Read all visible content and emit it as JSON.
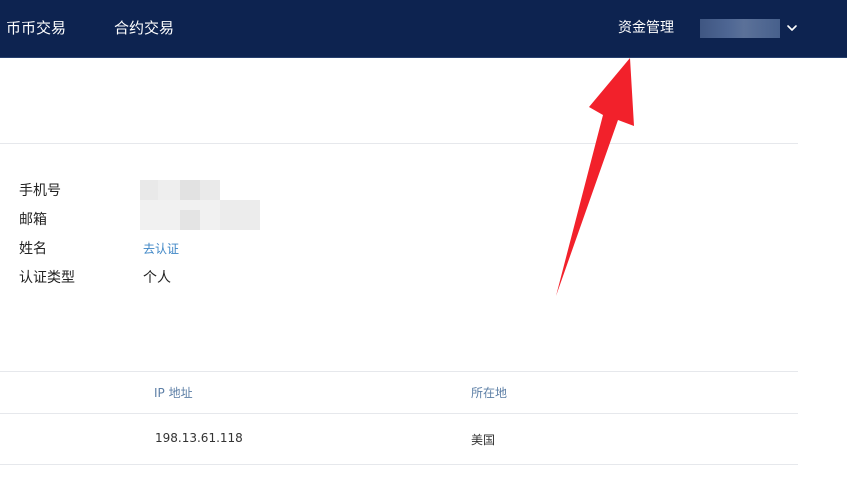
{
  "nav": {
    "spot_trading": "币币交易",
    "contract_trading": "合约交易",
    "asset_management": "资金管理",
    "account_menu_icon": "chevron-down-icon"
  },
  "profile": {
    "phone_label": "手机号",
    "email_label": "邮箱",
    "name_label": "姓名",
    "name_action": "去认证",
    "cert_type_label": "认证类型",
    "cert_type_value": "个人"
  },
  "login_table": {
    "headers": [
      "IP 地址",
      "所在地"
    ],
    "rows": [
      {
        "ip": "198.13.61.118",
        "location": "美国"
      }
    ]
  },
  "colors": {
    "topbar_bg": "#0d2350",
    "link": "#3e86c6",
    "annotation_arrow": "#f2212b"
  }
}
